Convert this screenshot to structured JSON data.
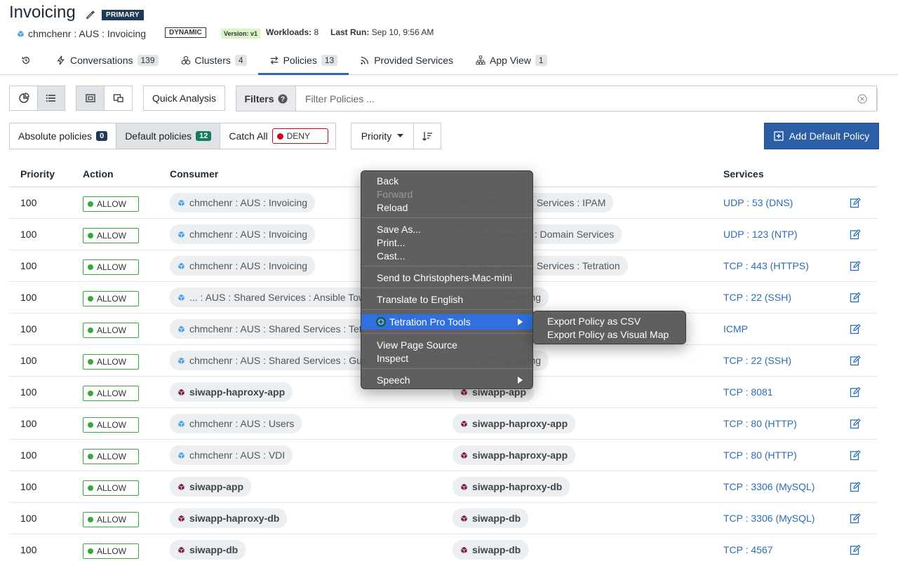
{
  "header": {
    "title": "Invoicing",
    "primary_badge": "PRIMARY",
    "scope": "chmchenr : AUS : Invoicing",
    "dynamic_badge": "DYNAMIC",
    "version_badge": "Version: v1",
    "workloads_label": "Workloads:",
    "workloads_value": "8",
    "last_run_label": "Last Run:",
    "last_run_value": "Sep 10, 9:56 AM"
  },
  "tabs": [
    {
      "label": "",
      "icon": "history-icon"
    },
    {
      "label": "Conversations",
      "count": "139",
      "icon": "bolt-icon"
    },
    {
      "label": "Clusters",
      "count": "4",
      "icon": "cubes-icon"
    },
    {
      "label": "Policies",
      "count": "13",
      "icon": "exchange-icon",
      "active": true
    },
    {
      "label": "Provided Services",
      "icon": "rss-icon"
    },
    {
      "label": "App View",
      "count": "1",
      "icon": "sitemap-icon"
    }
  ],
  "toolbar": {
    "quick_analysis": "Quick Analysis",
    "filters_label": "Filters",
    "filter_placeholder": "Filter Policies ..."
  },
  "policy_tabs": {
    "absolute_label": "Absolute policies",
    "absolute_count": "0",
    "default_label": "Default policies",
    "default_count": "12",
    "catch_all_label": "Catch All",
    "deny_label": "DENY",
    "priority_label": "Priority",
    "add_button": "Add Default Policy"
  },
  "table": {
    "headers": {
      "priority": "Priority",
      "action": "Action",
      "consumer": "Consumer",
      "services": "Services"
    },
    "rows": [
      {
        "priority": "100",
        "action": "ALLOW",
        "consumer": "chmchenr : AUS : Invoicing",
        "consumer_bold": false,
        "provider": "...US : Shared Services : IPAM",
        "provider_bold": false,
        "service": "UDP : 53 (DNS)"
      },
      {
        "priority": "100",
        "action": "ALLOW",
        "consumer": "chmchenr : AUS : Invoicing",
        "consumer_bold": false,
        "provider": "...ed Services : Domain Services",
        "provider_bold": false,
        "service": "UDP : 123 (NTP)"
      },
      {
        "priority": "100",
        "action": "ALLOW",
        "consumer": "chmchenr : AUS : Invoicing",
        "consumer_bold": false,
        "provider": "...US : Shared Services : Tetration",
        "provider_bold": false,
        "service": "TCP : 443 (HTTPS)"
      },
      {
        "priority": "100",
        "action": "ALLOW",
        "consumer": "... : AUS : Shared Services : Ansible Tow",
        "consumer_bold": false,
        "provider": "...US : Invoicing",
        "provider_bold": false,
        "service": "TCP : 22 (SSH)"
      },
      {
        "priority": "100",
        "action": "ALLOW",
        "consumer": "chmchenr : AUS : Shared Services : Tetr",
        "consumer_bold": false,
        "provider": "",
        "provider_bold": false,
        "service": "ICMP"
      },
      {
        "priority": "100",
        "action": "ALLOW",
        "consumer": "chmchenr : AUS : Shared Services : Gua",
        "consumer_bold": false,
        "provider": "...US : Invoicing",
        "provider_bold": false,
        "service": "TCP : 22 (SSH)"
      },
      {
        "priority": "100",
        "action": "ALLOW",
        "consumer": "siwapp-haproxy-app",
        "consumer_bold": true,
        "provider": "siwapp-app",
        "provider_bold": true,
        "service": "TCP : 8081"
      },
      {
        "priority": "100",
        "action": "ALLOW",
        "consumer": "chmchenr : AUS : Users",
        "consumer_bold": false,
        "provider": "siwapp-haproxy-app",
        "provider_bold": true,
        "service": "TCP : 80 (HTTP)"
      },
      {
        "priority": "100",
        "action": "ALLOW",
        "consumer": "chmchenr : AUS : VDI",
        "consumer_bold": false,
        "provider": "siwapp-haproxy-app",
        "provider_bold": true,
        "service": "TCP : 80 (HTTP)"
      },
      {
        "priority": "100",
        "action": "ALLOW",
        "consumer": "siwapp-app",
        "consumer_bold": true,
        "provider": "siwapp-haproxy-db",
        "provider_bold": true,
        "service": "TCP : 3306 (MySQL)"
      },
      {
        "priority": "100",
        "action": "ALLOW",
        "consumer": "siwapp-haproxy-db",
        "consumer_bold": true,
        "provider": "siwapp-db",
        "provider_bold": true,
        "service": "TCP : 3306 (MySQL)"
      },
      {
        "priority": "100",
        "action": "ALLOW",
        "consumer": "siwapp-db",
        "consumer_bold": true,
        "provider": "siwapp-db",
        "provider_bold": true,
        "service": "TCP : 4567"
      }
    ]
  },
  "context_menu": {
    "items": [
      "Back",
      "Forward",
      "Reload",
      "Save As...",
      "Print...",
      "Cast...",
      "Send to Christophers-Mac-mini",
      "Translate to English",
      "Tetration Pro Tools",
      "View Page Source",
      "Inspect",
      "Speech"
    ],
    "submenu": [
      "Export Policy as CSV",
      "Export Policy as Visual Map"
    ]
  },
  "colors": {
    "accent": "#2a6db5",
    "primary_button": "#2a5fa8",
    "allow": "#35a83a",
    "deny": "#d0021b",
    "menu_highlight": "#2f6fe0"
  }
}
